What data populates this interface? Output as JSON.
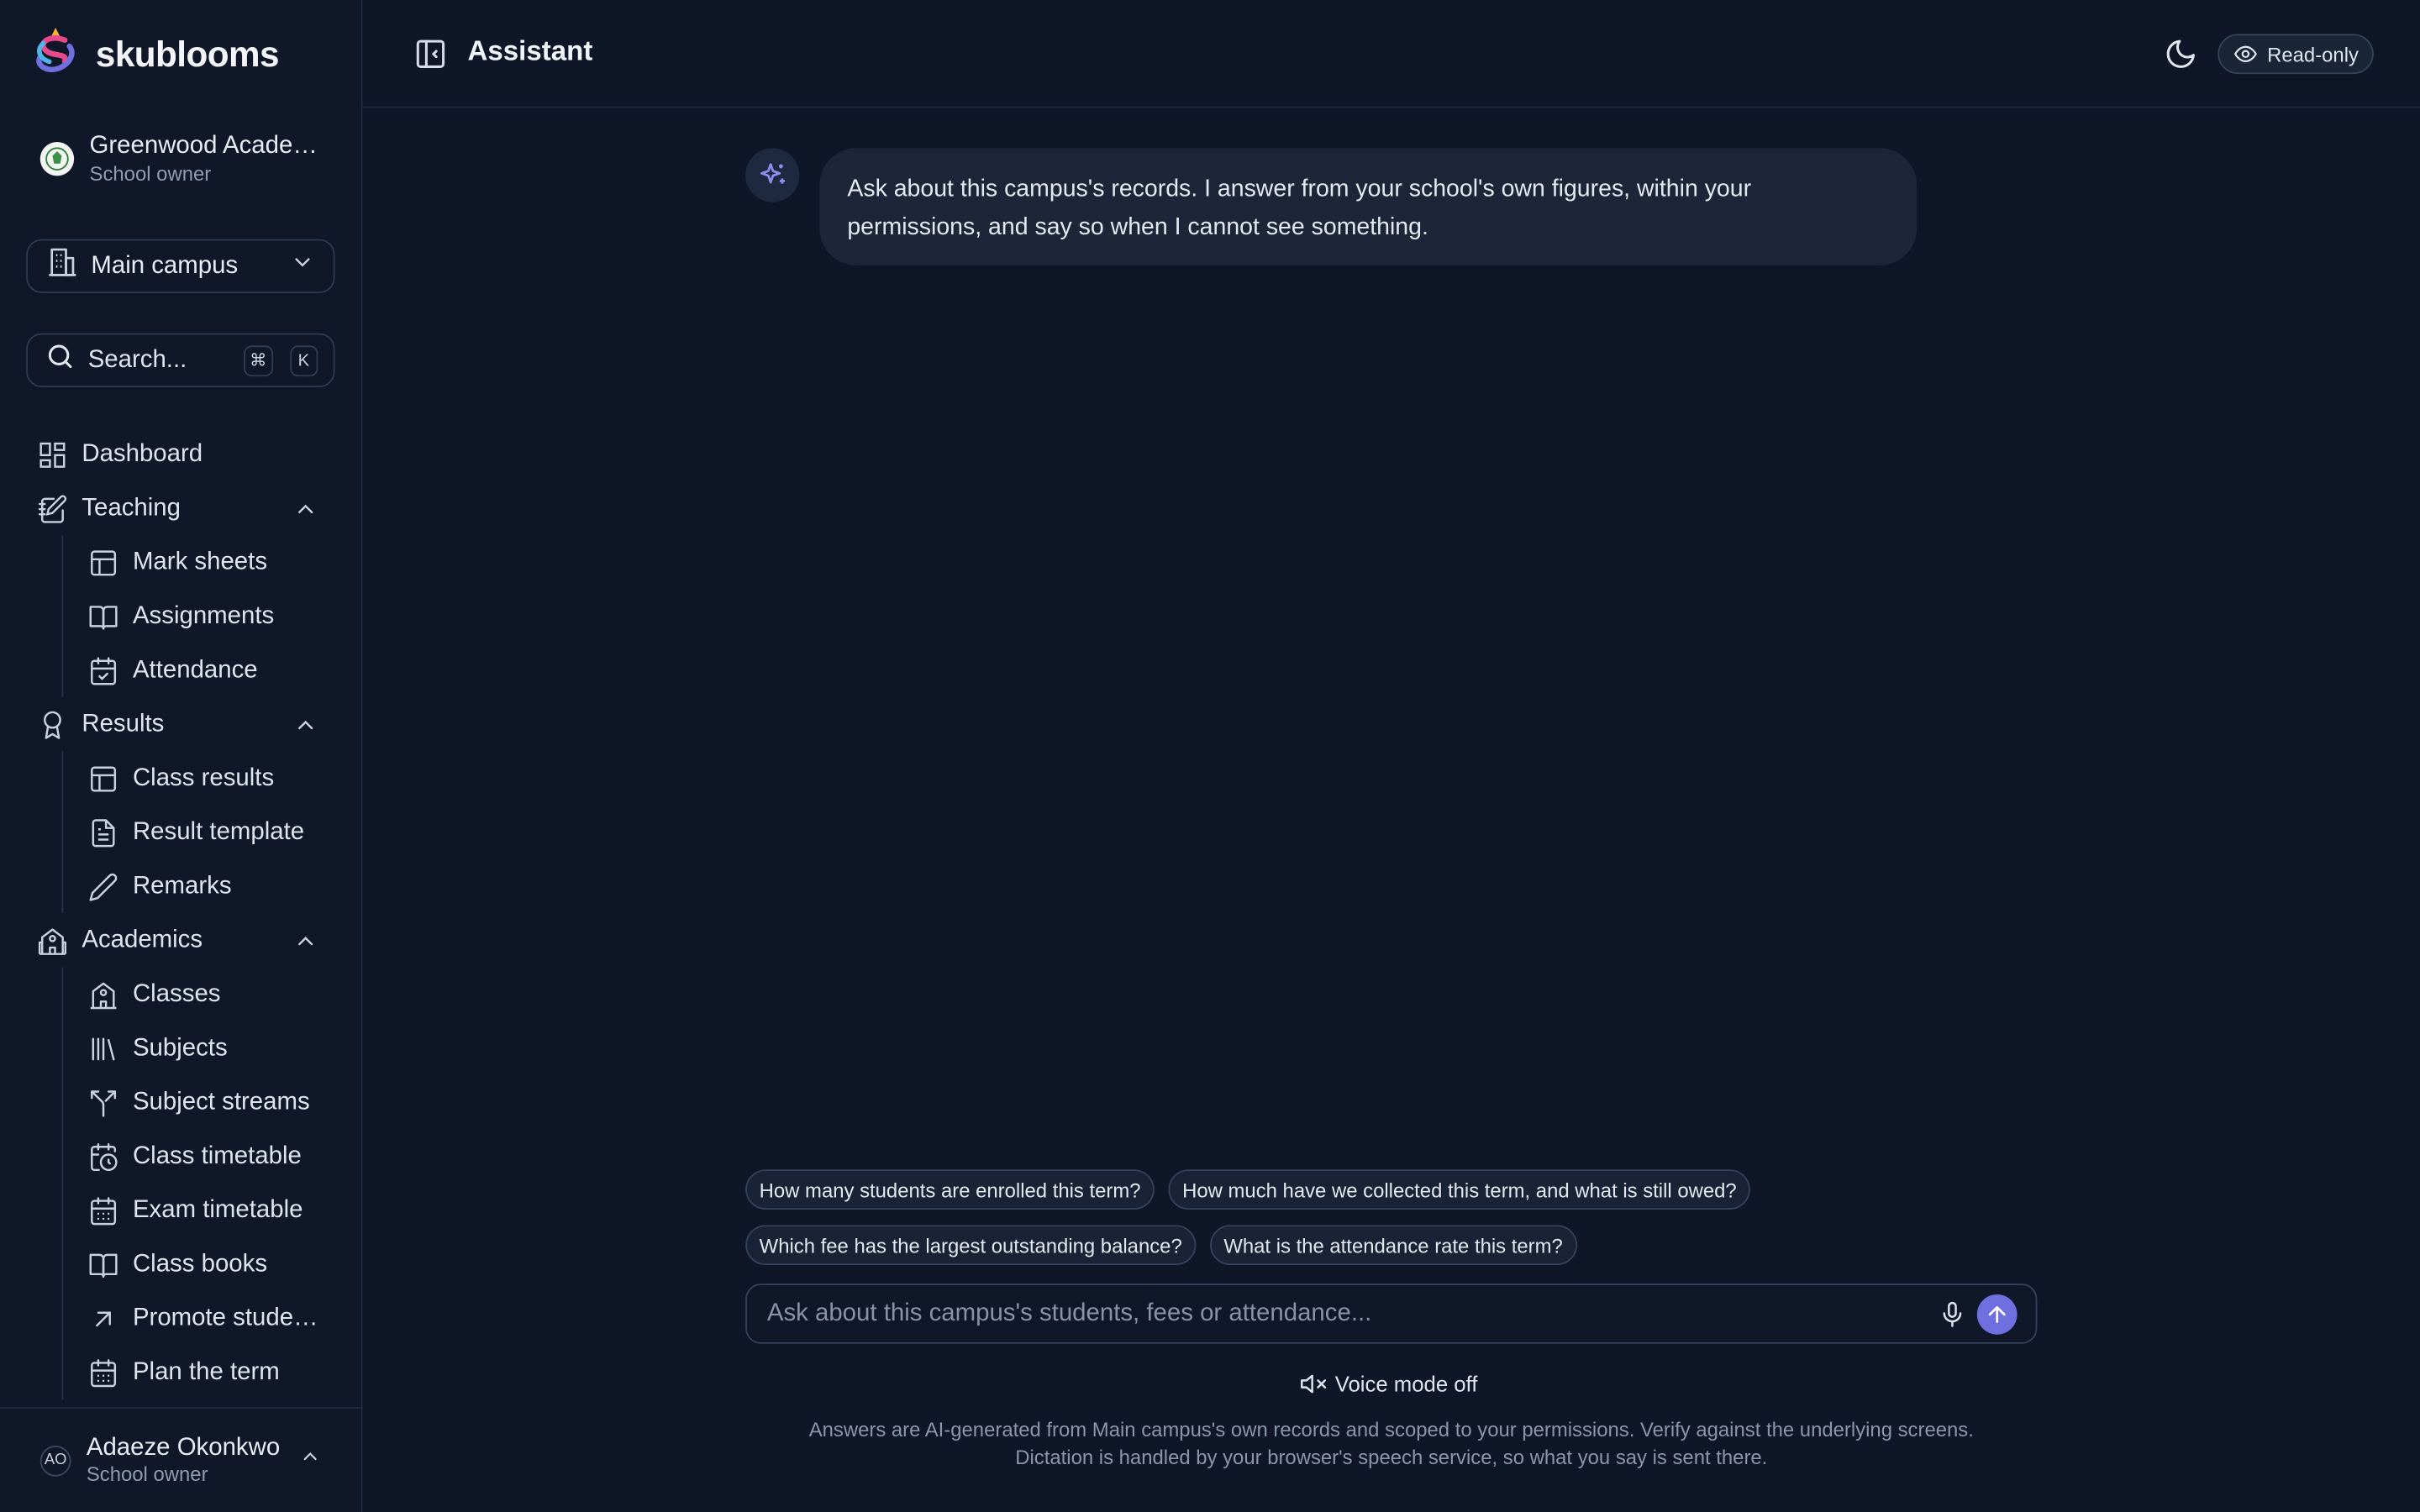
{
  "brand": {
    "name": "skublooms"
  },
  "org": {
    "name": "Greenwood Acade…",
    "role": "School owner"
  },
  "campus": {
    "label": "Main campus"
  },
  "search": {
    "placeholder": "Search...",
    "key1": "⌘",
    "key2": "K"
  },
  "nav": {
    "dashboard": "Dashboard",
    "teaching": "Teaching",
    "mark_sheets": "Mark sheets",
    "assignments": "Assignments",
    "attendance": "Attendance",
    "results": "Results",
    "class_results": "Class results",
    "result_template": "Result template",
    "remarks": "Remarks",
    "academics": "Academics",
    "classes": "Classes",
    "subjects": "Subjects",
    "subject_streams": "Subject streams",
    "class_timetable": "Class timetable",
    "exam_timetable": "Exam timetable",
    "class_books": "Class books",
    "promote_students": "Promote stude…",
    "plan_term": "Plan the term"
  },
  "user": {
    "initials": "AO",
    "name": "Adaeze Okonkwo",
    "role": "School owner"
  },
  "header": {
    "title": "Assistant",
    "readonly": "Read-only"
  },
  "assistant": {
    "message": "Ask about this campus's records. I answer from your school's own figures, within your permissions, and say so when I cannot see something."
  },
  "suggestions": [
    "How many students are enrolled this term?",
    "How much have we collected this term, and what is still owed?",
    "Which fee has the largest outstanding balance?",
    "What is the attendance rate this term?"
  ],
  "composer": {
    "placeholder": "Ask about this campus's students, fees or attendance..."
  },
  "voice": {
    "label": "Voice mode off"
  },
  "disclaimer": {
    "line1": "Answers are AI-generated from Main campus's own records and scoped to your permissions. Verify against the underlying screens.",
    "line2": "Dictation is handled by your browser's speech service, so what you say is sent there."
  },
  "colors": {
    "background": "#0e1628",
    "accent": "#6f6fe0",
    "bubble": "#1c2638"
  }
}
